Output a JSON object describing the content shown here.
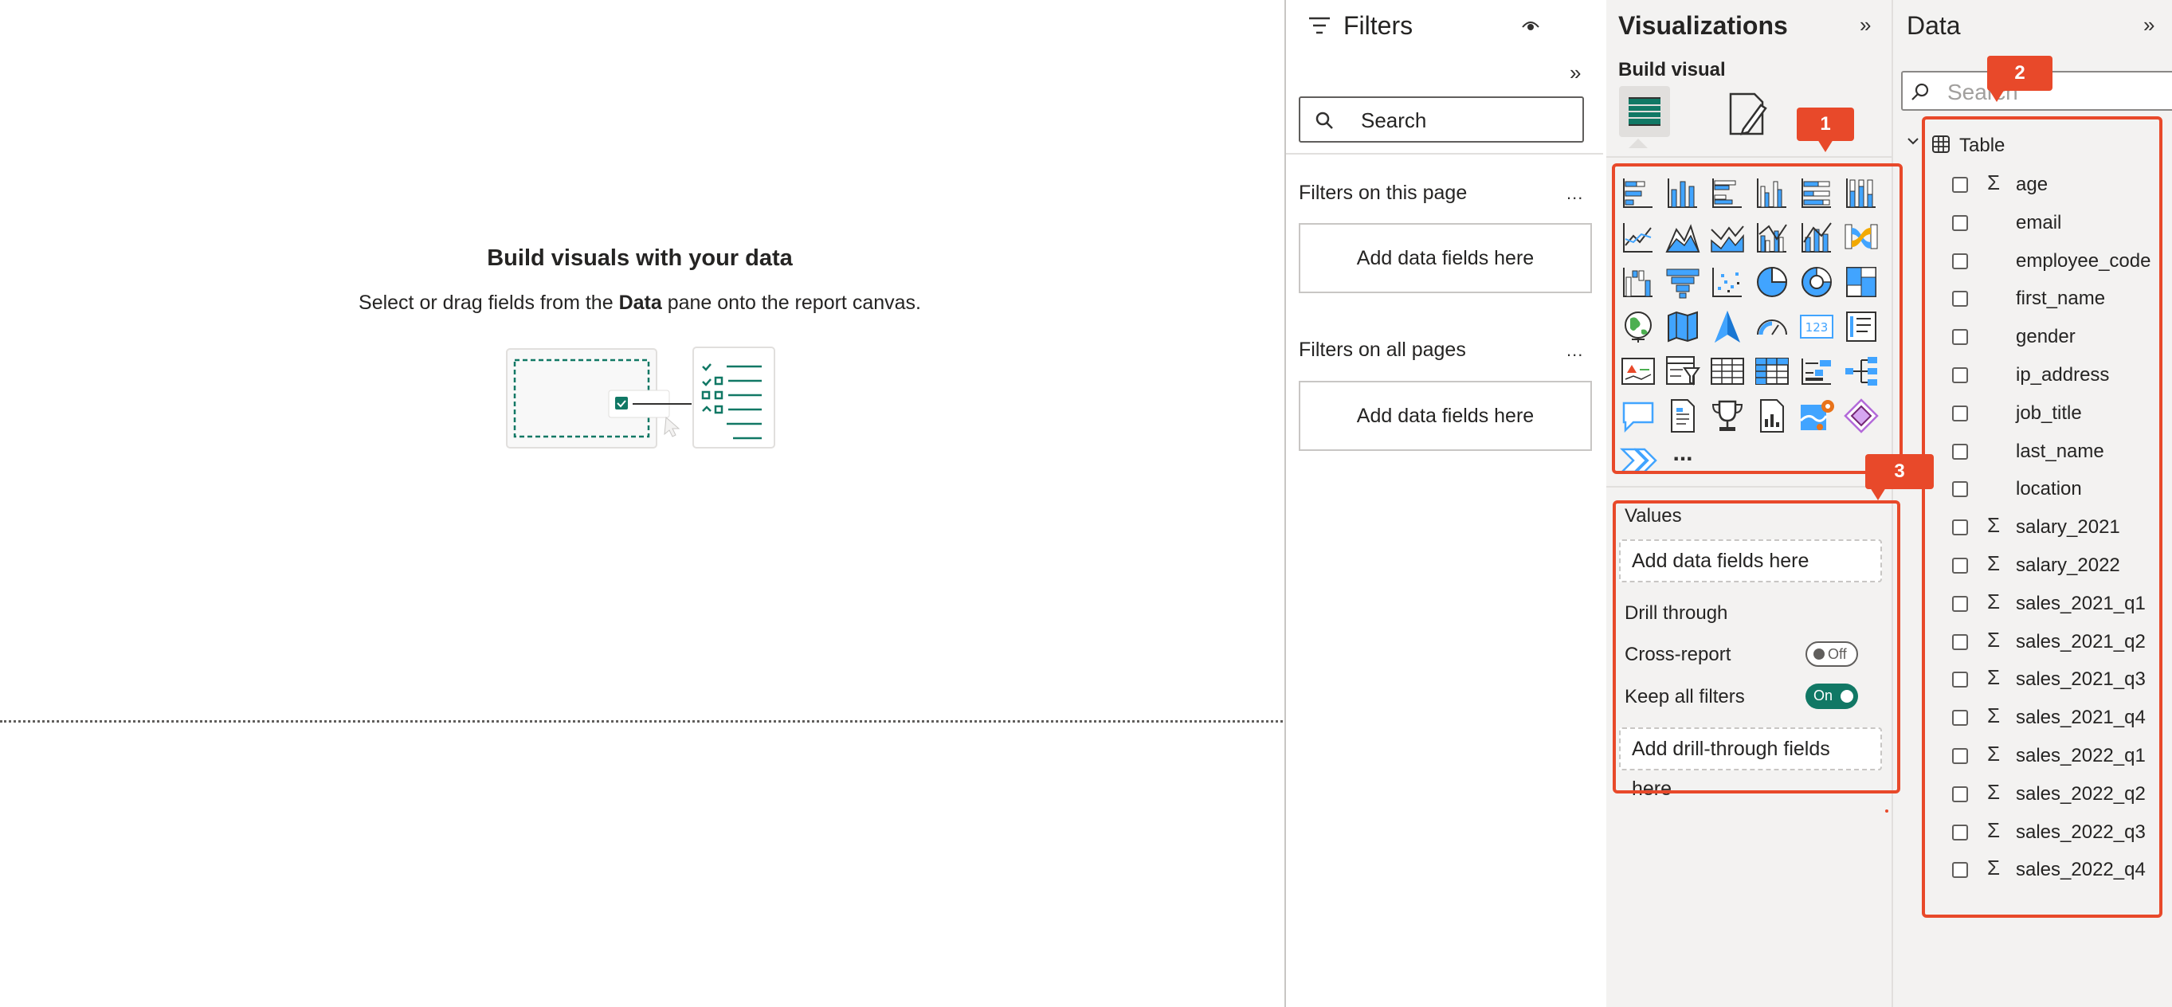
{
  "canvas": {
    "heading": "Build visuals with your data",
    "subtitle_before": "Select or drag fields from the ",
    "subtitle_bold": "Data",
    "subtitle_after": " pane onto the report canvas."
  },
  "filters": {
    "title": "Filters",
    "search_placeholder": "Search",
    "section_page": "Filters on this page",
    "section_all": "Filters on all pages",
    "more_glyph": "...",
    "drop_page": "Add data fields here",
    "drop_all": "Add data fields here"
  },
  "visualizations": {
    "title": "Visualizations",
    "build_visual": "Build visual",
    "more_visuals_glyph": "...",
    "values_label": "Values",
    "values_drop": "Add data fields here",
    "drill_through_label": "Drill through",
    "cross_report_label": "Cross-report",
    "cross_report_state": "Off",
    "keep_filters_label": "Keep all filters",
    "keep_filters_state": "On",
    "drill_drop": "Add drill-through fields here",
    "accent_color": "#117865",
    "visual_icons": [
      [
        "stacked-bar-chart-icon",
        "stacked-column-chart-icon",
        "clustered-bar-chart-icon",
        "clustered-column-chart-icon",
        "100-stacked-bar-chart-icon",
        "100-stacked-column-chart-icon"
      ],
      [
        "line-chart-icon",
        "area-chart-icon",
        "stacked-area-chart-icon",
        "line-clustered-column-chart-icon",
        "line-stacked-column-chart-icon",
        "ribbon-chart-icon"
      ],
      [
        "waterfall-chart-icon",
        "funnel-chart-icon",
        "scatter-chart-icon",
        "pie-chart-icon",
        "donut-chart-icon",
        "treemap-icon"
      ],
      [
        "map-icon",
        "filled-map-icon",
        "azure-map-icon",
        "gauge-icon",
        "card-icon",
        "multi-row-card-icon"
      ],
      [
        "kpi-icon",
        "slicer-icon",
        "table-icon",
        "matrix-icon",
        "key-influencers-icon",
        "decomposition-tree-icon"
      ],
      [
        "qna-icon",
        "paginated-report-icon",
        "goals-icon",
        "r-visual-icon",
        "arcgis-map-icon",
        "power-apps-icon"
      ],
      [
        "power-automate-icon",
        "more-visuals-icon"
      ]
    ]
  },
  "data": {
    "title": "Data",
    "search_placeholder": "Search",
    "table_name": "Table",
    "fields": [
      {
        "name": "age",
        "sigma": true
      },
      {
        "name": "email",
        "sigma": false
      },
      {
        "name": "employee_code",
        "sigma": false
      },
      {
        "name": "first_name",
        "sigma": false
      },
      {
        "name": "gender",
        "sigma": false
      },
      {
        "name": "ip_address",
        "sigma": false
      },
      {
        "name": "job_title",
        "sigma": false
      },
      {
        "name": "last_name",
        "sigma": false
      },
      {
        "name": "location",
        "sigma": false
      },
      {
        "name": "salary_2021",
        "sigma": true
      },
      {
        "name": "salary_2022",
        "sigma": true
      },
      {
        "name": "sales_2021_q1",
        "sigma": true
      },
      {
        "name": "sales_2021_q2",
        "sigma": true
      },
      {
        "name": "sales_2021_q3",
        "sigma": true
      },
      {
        "name": "sales_2021_q4",
        "sigma": true
      },
      {
        "name": "sales_2022_q1",
        "sigma": true
      },
      {
        "name": "sales_2022_q2",
        "sigma": true
      },
      {
        "name": "sales_2022_q3",
        "sigma": true
      },
      {
        "name": "sales_2022_q4",
        "sigma": true
      }
    ],
    "sigma_glyph": "Σ"
  },
  "annotations": {
    "tag_1": "1",
    "tag_2": "2",
    "tag_3": "3",
    "color": "#e8492a"
  }
}
